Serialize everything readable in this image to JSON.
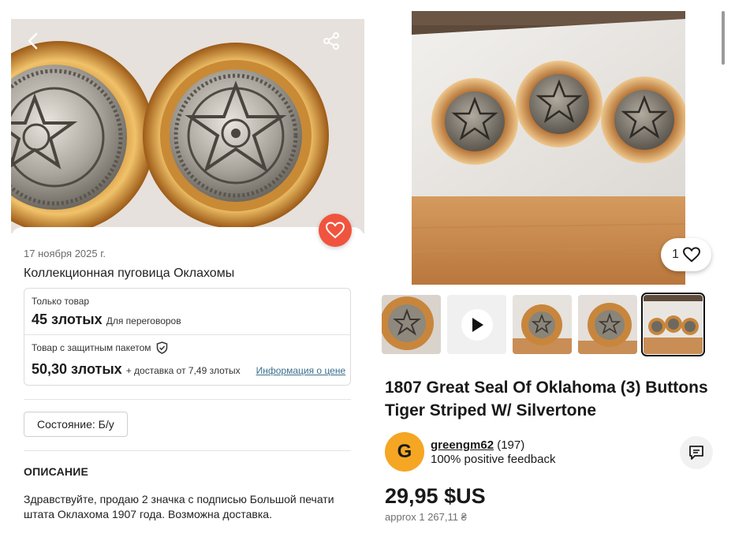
{
  "listing": {
    "date": "17 ноября 2025 г.",
    "title": "Коллекционная пуговица Оклахомы",
    "goods_only_label": "Только товар",
    "goods_only_price": "45 злотых",
    "goods_only_note": "Для переговоров",
    "protection_label": "Товар с защитным пакетом",
    "protection_price": "50,30 злотых",
    "protection_delivery": "+ доставка от 7,49 злотых",
    "price_info_link": "Информация о цене",
    "condition": "Состояние: Б/у",
    "description_heading": "ОПИСАНИЕ",
    "description_text": "Здравствуйте, продаю 2 значка с подписью Большой печати штата Оклахома 1907 года. Возможна доставка."
  },
  "product": {
    "like_count": "1",
    "title": "1807 Great Seal Of Oklahoma (3) Buttons Tiger Striped W/ Silvertone",
    "seller": {
      "avatar_letter": "G",
      "name": "greengm62",
      "rating_count": "(197)",
      "feedback": "100% positive feedback"
    },
    "price": "29,95 $US",
    "price_approx": "approx 1 267,11 ₴"
  },
  "colors": {
    "favorite_button": "#f0543e",
    "avatar": "#f5a623",
    "link": "#3b6f8c"
  },
  "icons": [
    "back-arrow-icon",
    "share-icon",
    "heart-icon",
    "shield-check-icon",
    "play-icon",
    "chat-icon"
  ]
}
